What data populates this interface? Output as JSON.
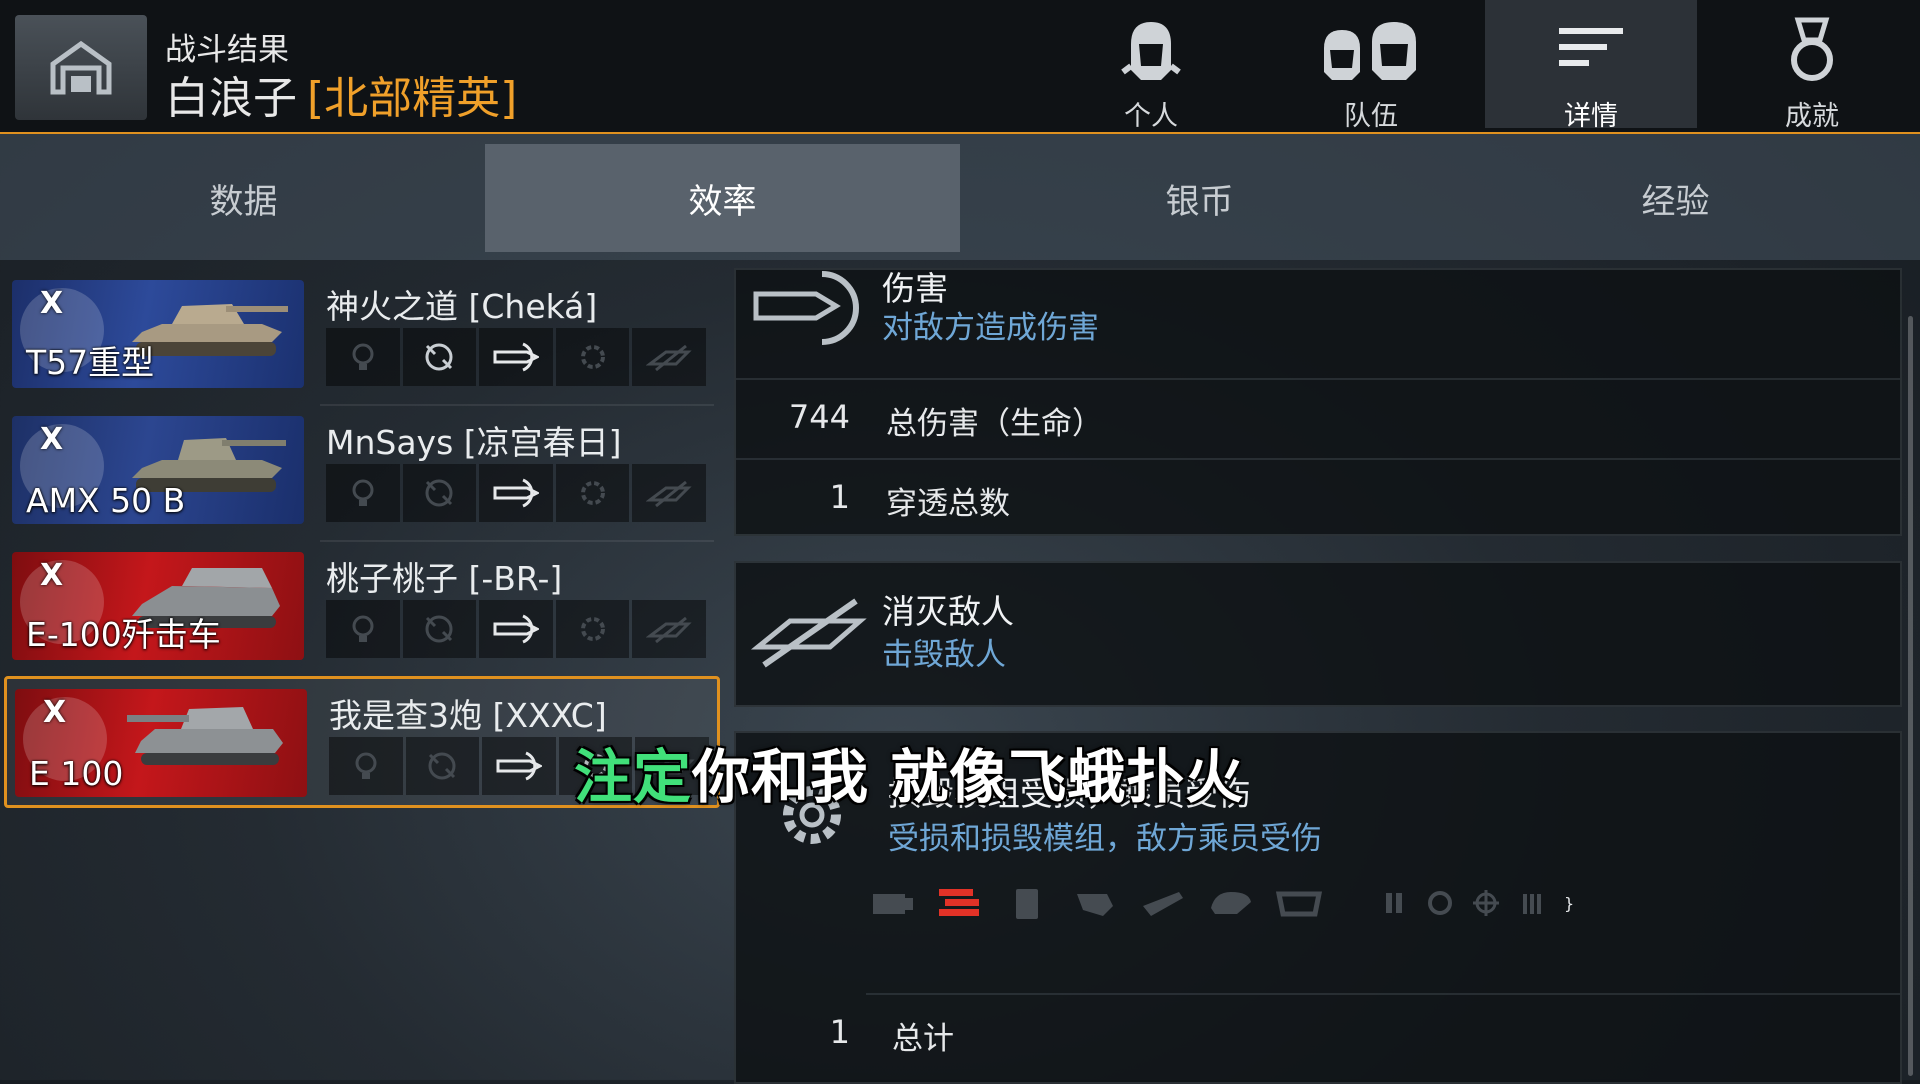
{
  "header": {
    "battle_label": "战斗结果",
    "player_name": "白浪子",
    "player_clan": "[北部精英]",
    "accent_color": "#e0911f",
    "nav_tabs": [
      {
        "label": "个人",
        "icon": "personal-helmet-icon"
      },
      {
        "label": "队伍",
        "icon": "team-helmets-icon"
      },
      {
        "label": "详情",
        "icon": "details-list-icon",
        "active": true
      },
      {
        "label": "成就",
        "icon": "achievement-medal-icon"
      }
    ]
  },
  "subtabs": [
    {
      "label": "数据"
    },
    {
      "label": "效率",
      "active": true
    },
    {
      "label": "银币"
    },
    {
      "label": "经验"
    }
  ],
  "players": [
    {
      "name": "神火之道 [Cheká]",
      "tank": "T57重型",
      "tier": "X",
      "nation": "usa",
      "color": "#2d4a9a",
      "medals_active": [
        "damage"
      ]
    },
    {
      "name": "MnSays [凉宫春日]",
      "tank": "AMX 50 B",
      "tier": "X",
      "nation": "france",
      "color": "#2c4690",
      "medals_active": [
        "damage"
      ]
    },
    {
      "name": "桃子桃子 [-BR-]",
      "tank": "E-100歼击车",
      "tier": "X",
      "nation": "germany",
      "color": "#c4171b",
      "medals_active": [
        "damage"
      ]
    },
    {
      "name": "我是查3炮 [XXXC]",
      "tank": "E 100",
      "tier": "X",
      "nation": "germany",
      "color": "#c4171b",
      "selected": true,
      "medals_active": [
        "damage"
      ]
    }
  ],
  "details": {
    "damage": {
      "title": "伤害",
      "subtitle": "对敌方造成伤害",
      "rows": [
        {
          "value": "744",
          "label": "总伤害（生命）"
        },
        {
          "value": "1",
          "label": "穿透总数"
        }
      ]
    },
    "destroy": {
      "title": "消灭敌人",
      "subtitle": "击毁敌人"
    },
    "modules": {
      "title": "损毁模组受损，乘员受伤",
      "subtitle": "受损和损毁模组，敌方乘员受伤",
      "module_icons": [
        "engine-icon",
        "tracks-icon",
        "fuel-tank-icon",
        "ammo-rack-icon",
        "gun-icon",
        "turret-icon",
        "hull-icon",
        "commander-icon",
        "driver-icon",
        "gunner-icon",
        "loader-icon"
      ],
      "damaged_module": "tracks-icon",
      "total_value": "1",
      "total_label": "总计"
    }
  },
  "caption": {
    "highlight": "注定",
    "rest": "你和我 就像飞蛾扑火",
    "highlight_color": "#41e07a"
  }
}
